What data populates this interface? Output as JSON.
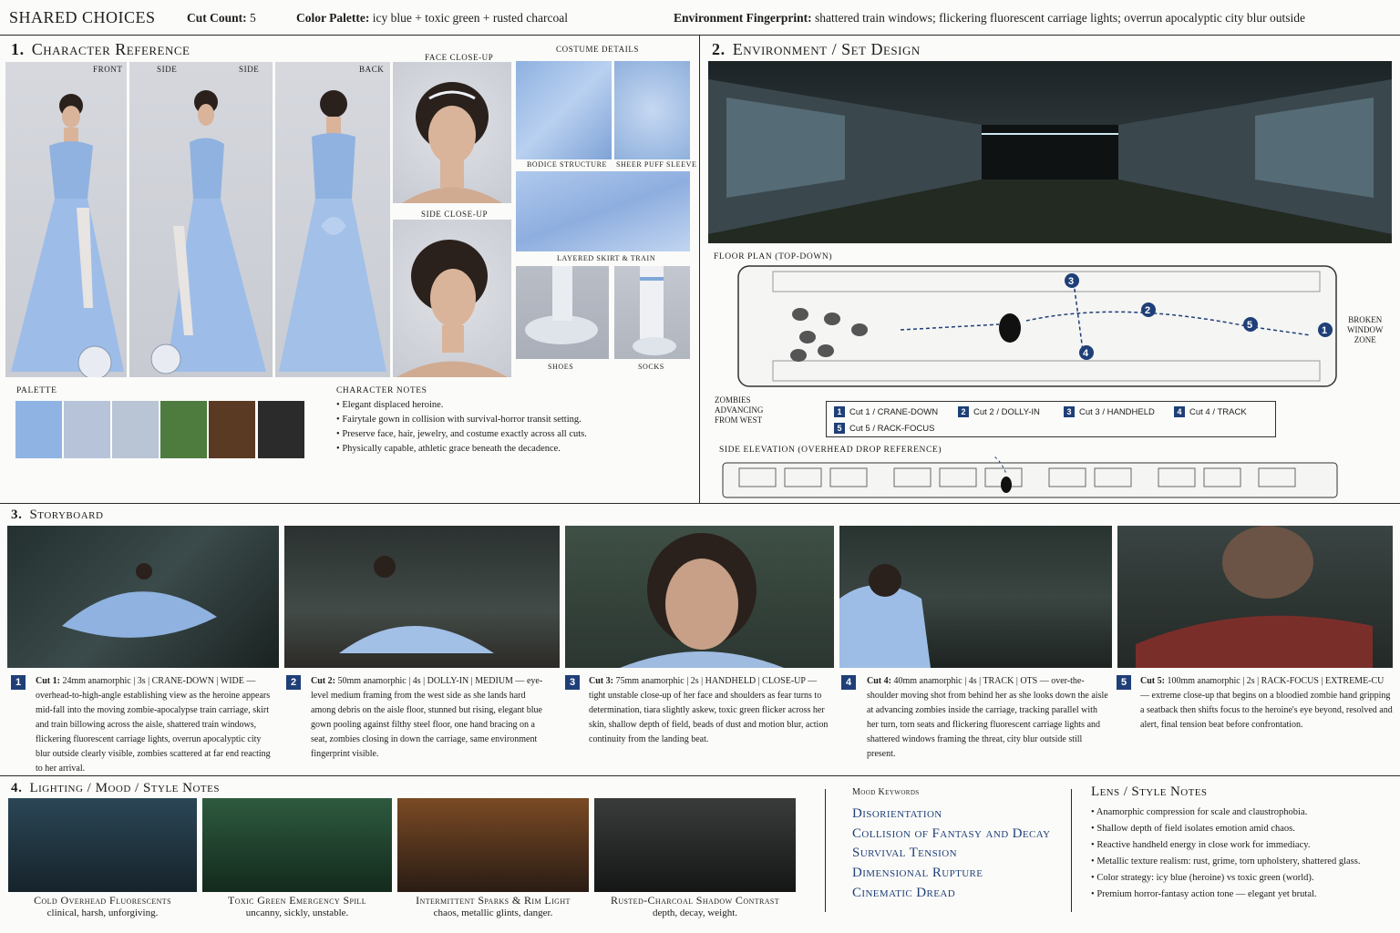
{
  "topbar": {
    "shared": "SHARED CHOICES",
    "cut_count_label": "Cut Count:",
    "cut_count_value": "5",
    "palette_label": "Color Palette:",
    "palette_value": "icy blue + toxic green + rusted charcoal",
    "env_label": "Environment Fingerprint:",
    "env_value": "shattered train windows; flickering fluorescent carriage lights; overrun apocalyptic city blur outside"
  },
  "character": {
    "num": "1.",
    "title": "Character Reference",
    "views": [
      "FRONT",
      "SIDE",
      "SIDE",
      "BACK"
    ],
    "face_closeup": "FACE CLOSE-UP",
    "side_closeup": "SIDE CLOSE-UP",
    "costume_title": "COSTUME DETAILS",
    "costume": {
      "bodice": "BODICE STRUCTURE",
      "sleeve": "SHEER PUFF SLEEVE",
      "skirt": "LAYERED SKIRT & TRAIN",
      "shoes": "SHOES",
      "socks": "SOCKS"
    },
    "palette_label": "PALETTE",
    "palette_colors": [
      "#8fb4e3",
      "#b7c3d8",
      "#b9c4d4",
      "#4e7b3e",
      "#5a3a22",
      "#2b2b2b"
    ],
    "notes_title": "CHARACTER NOTES",
    "notes": [
      "Elegant displaced heroine.",
      "Fairytale gown in collision with survival-horror transit setting.",
      "Preserve face, hair, jewelry, and costume exactly across all cuts.",
      "Physically capable, athletic grace beneath the decadence."
    ]
  },
  "environment": {
    "num": "2.",
    "title": "Environment / Set Design",
    "floor_plan": "FLOOR PLAN (TOP-DOWN)",
    "broken_window": [
      "BROKEN",
      "WINDOW",
      "ZONE"
    ],
    "zombies_label": [
      "ZOMBIES",
      "ADVANCING",
      "FROM WEST"
    ],
    "legend": [
      {
        "n": "1",
        "label": "Cut 1 / CRANE-DOWN"
      },
      {
        "n": "2",
        "label": "Cut 2 / DOLLY-IN"
      },
      {
        "n": "3",
        "label": "Cut 3 / HANDHELD"
      },
      {
        "n": "4",
        "label": "Cut 4 / TRACK"
      },
      {
        "n": "5",
        "label": "Cut 5 / RACK-FOCUS"
      }
    ],
    "side_elevation": "SIDE ELEVATION (OVERHEAD DROP REFERENCE)"
  },
  "storyboard": {
    "num": "3.",
    "title": "Storyboard",
    "cuts": [
      {
        "n": "1",
        "head": "Cut 1:",
        "spec": "24mm anamorphic | 3s | CRANE-DOWN | WIDE —",
        "body": "overhead-to-high-angle establishing view as the heroine appears mid-fall into the moving zombie-apocalypse train carriage, skirt and train billowing across the aisle, shattered train windows, flickering fluorescent carriage lights, overrun apocalyptic city blur outside clearly visible, zombies scattered at far end reacting to her arrival."
      },
      {
        "n": "2",
        "head": "Cut 2:",
        "spec": "50mm anamorphic | 4s | DOLLY-IN | MEDIUM —",
        "body": "eye-level medium framing from the west side as she lands hard among debris on the aisle floor, stunned but rising, elegant blue gown pooling against filthy steel floor, one hand bracing on a seat, zombies closing in down the carriage, same environment fingerprint visible."
      },
      {
        "n": "3",
        "head": "Cut 3:",
        "spec": "75mm anamorphic | 2s | HANDHELD | CLOSE-UP —",
        "body": "tight unstable close-up of her face and shoulders as fear turns to determination, tiara slightly askew, toxic green flicker across her skin, shallow depth of field, beads of dust and motion blur, action continuity from the landing beat."
      },
      {
        "n": "4",
        "head": "Cut 4:",
        "spec": "40mm anamorphic | 4s | TRACK | OTS —",
        "body": "over-the-shoulder moving shot from behind her as she looks down the aisle at advancing zombies inside the carriage, tracking parallel with her turn, torn seats and flickering fluorescent carriage lights and shattered windows framing the threat, city blur outside still present."
      },
      {
        "n": "5",
        "head": "Cut 5:",
        "spec": "100mm anamorphic | 2s | RACK-FOCUS | EXTREME-CU —",
        "body": "extreme close-up that begins on a bloodied zombie hand gripping a seatback then shifts focus to the heroine's eye beyond, resolved and alert, final tension beat before confrontation."
      }
    ]
  },
  "lighting": {
    "num": "4.",
    "title": "Lighting / Mood / Style Notes",
    "panels": [
      {
        "title": "Cold Overhead Fluorescents",
        "desc": "clinical, harsh, unforgiving."
      },
      {
        "title": "Toxic Green Emergency Spill",
        "desc": "uncanny, sickly, unstable."
      },
      {
        "title": "Intermittent Sparks & Rim Light",
        "desc": "chaos, metallic glints, danger."
      },
      {
        "title": "Rusted-Charcoal Shadow Contrast",
        "desc": "depth, decay, weight."
      }
    ],
    "mood_title": "Mood Keywords",
    "mood": [
      "Disorientation",
      "Collision of Fantasy and Decay",
      "Survival Tension",
      "Dimensional Rupture",
      "Cinematic Dread"
    ],
    "lens_title": "Lens / Style Notes",
    "lens": [
      "Anamorphic compression for scale and claustrophobia.",
      "Shallow depth of field isolates emotion amid chaos.",
      "Reactive handheld energy in close work for immediacy.",
      "Metallic texture realism: rust, grime, torn upholstery, shattered glass.",
      "Color strategy: icy blue (heroine) vs toxic green (world).",
      "Premium horror-fantasy action tone — elegant yet brutal."
    ]
  }
}
